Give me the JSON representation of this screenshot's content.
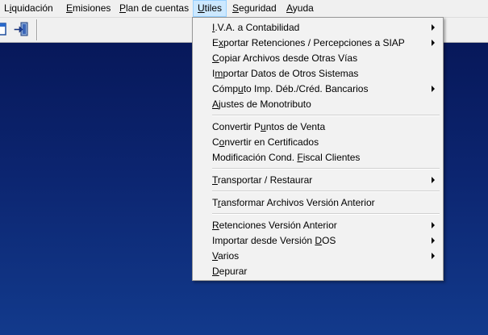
{
  "menubar": {
    "items": [
      {
        "pre": "L",
        "acc": "i",
        "post": "quidación"
      },
      {
        "pre": "",
        "acc": "E",
        "post": "misiones"
      },
      {
        "pre": "",
        "acc": "P",
        "post": "lan de cuentas"
      },
      {
        "pre": "",
        "acc": "U",
        "post": "tiles"
      },
      {
        "pre": "",
        "acc": "S",
        "post": "eguridad"
      },
      {
        "pre": "",
        "acc": "A",
        "post": "yuda"
      }
    ]
  },
  "toolbar": {
    "buttons": [
      {
        "icon": "window-icon"
      },
      {
        "icon": "exit-door-icon"
      }
    ]
  },
  "dropdown": {
    "items": [
      {
        "pre": "",
        "acc": "I",
        "post": ".V.A. a Contabilidad",
        "submenu": true
      },
      {
        "pre": "E",
        "acc": "x",
        "post": "portar Retenciones / Percepciones a SIAP",
        "submenu": true
      },
      {
        "pre": "",
        "acc": "C",
        "post": "opiar Archivos desde Otras Vías",
        "submenu": false
      },
      {
        "pre": "I",
        "acc": "m",
        "post": "portar Datos de Otros Sistemas",
        "submenu": false
      },
      {
        "pre": "Cómp",
        "acc": "u",
        "post": "to Imp. Déb./Créd. Bancarios",
        "submenu": true
      },
      {
        "pre": "",
        "acc": "A",
        "post": "justes de Monotributo",
        "submenu": false
      },
      {
        "pre": "Convertir P",
        "acc": "u",
        "post": "ntos de Venta",
        "submenu": false
      },
      {
        "pre": "C",
        "acc": "o",
        "post": "nvertir en Certificados",
        "submenu": false
      },
      {
        "pre": "Modificación Cond. ",
        "acc": "F",
        "post": "iscal Clientes",
        "submenu": false
      },
      {
        "pre": "",
        "acc": "T",
        "post": "ransportar / Restaurar",
        "submenu": true
      },
      {
        "pre": "T",
        "acc": "r",
        "post": "ansformar Archivos Versión Anterior",
        "submenu": false
      },
      {
        "pre": "",
        "acc": "R",
        "post": "etenciones Versión Anterior",
        "submenu": true
      },
      {
        "pre": "Importar desde Versión ",
        "acc": "D",
        "post": "OS",
        "submenu": true
      },
      {
        "pre": "",
        "acc": "V",
        "post": "arios",
        "submenu": true
      },
      {
        "pre": "",
        "acc": "D",
        "post": "epurar",
        "submenu": false
      }
    ]
  }
}
